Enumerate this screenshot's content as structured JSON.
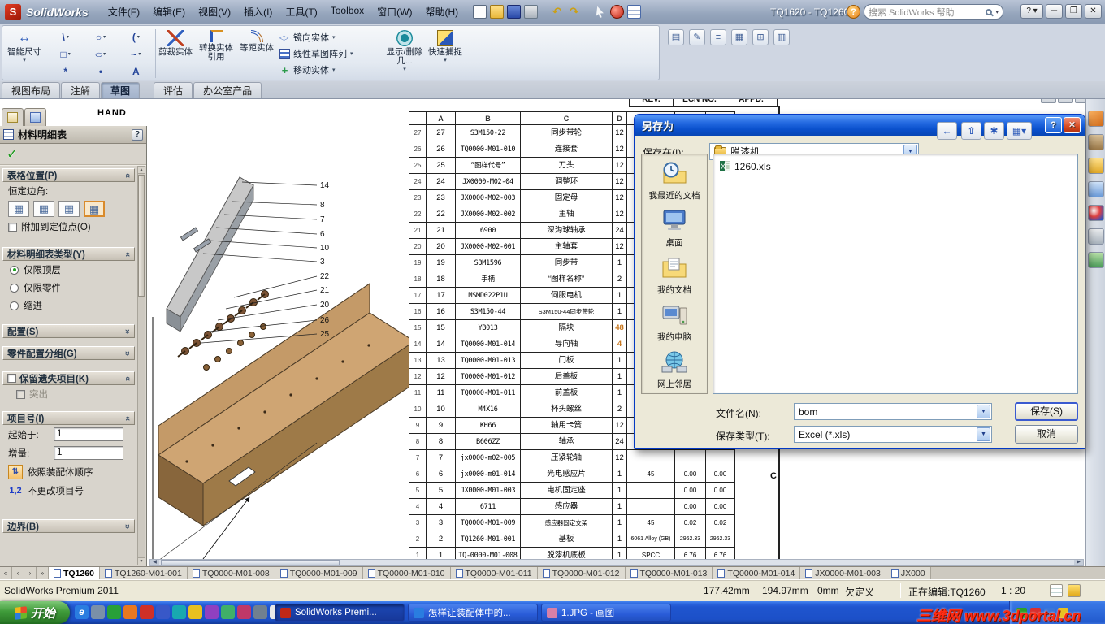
{
  "titlebar": {
    "app_name": "SolidWorks",
    "doc_title": "TQ1620 - TQ1260",
    "search_placeholder": "搜索 SolidWorks 帮助",
    "menus": [
      "文件(F)",
      "编辑(E)",
      "视图(V)",
      "插入(I)",
      "工具(T)",
      "Toolbox",
      "窗口(W)",
      "帮助(H)"
    ]
  },
  "ribbon": {
    "smart_dimension": "智能尺寸",
    "big_buttons": [
      "剪裁实体",
      "转换实体引用",
      "等距实体"
    ],
    "text_buttons": [
      "镜向实体",
      "线性草图阵列",
      "移动实体"
    ],
    "right_big_buttons": [
      "显示/删除几...",
      "快速捕捉"
    ],
    "tabs": [
      {
        "label": "视图布局",
        "active": false
      },
      {
        "label": "注解",
        "active": false
      },
      {
        "label": "草图",
        "active": true
      },
      {
        "label": "评估",
        "active": false
      },
      {
        "label": "办公室产品",
        "active": false
      }
    ]
  },
  "panel": {
    "title": "材料明细表",
    "help": "?",
    "table_position": {
      "header": "表格位置(P)",
      "anchor_label": "恒定边角:",
      "attach_label": "附加到定位点(O)"
    },
    "bom_type": {
      "header": "材料明细表类型(Y)",
      "options": [
        "仅限顶层",
        "仅限零件",
        "缩进"
      ],
      "selected": "仅限顶层"
    },
    "configurations_header": "配置(S)",
    "part_grouping_header": "零件配置分组(G)",
    "keep_missing": {
      "header": "保留遗失项目(K)",
      "strikeout_label": "突出"
    },
    "item_numbers": {
      "header": "项目号(I)",
      "start_label": "起始于:",
      "start_value": "1",
      "increment_label": "增量:",
      "increment_value": "1",
      "follow_assembly_label": "依照装配体顺序",
      "badge": "1,2",
      "no_change_label": "不更改项目号"
    },
    "border_header": "边界(B)"
  },
  "drawing": {
    "note": "HAND",
    "zone_letter": "C",
    "rev_headers": [
      "REV.",
      "ECN NO.",
      "APPD."
    ],
    "balloons": [
      "14",
      "8",
      "7",
      "6",
      "10",
      "3",
      "22",
      "21",
      "20",
      "26",
      "25"
    ],
    "bom": {
      "zone_cols": [
        "A",
        "B",
        "C",
        "D"
      ],
      "rows": [
        {
          "item": "27",
          "part": "S3M150-22",
          "desc": "同步带轮",
          "qty": "12"
        },
        {
          "item": "26",
          "part": "TQ0000-M01-010",
          "desc": "连接套",
          "qty": "12"
        },
        {
          "item": "25",
          "part": "“图样代号”",
          "desc": "刀头",
          "qty": "12"
        },
        {
          "item": "24",
          "part": "JX0000-M02-04",
          "desc": "调整环",
          "qty": "12"
        },
        {
          "item": "23",
          "part": "JX0000-M02-003",
          "desc": "固定母",
          "qty": "12"
        },
        {
          "item": "22",
          "part": "JX0000-M02-002",
          "desc": "主轴",
          "qty": "12"
        },
        {
          "item": "21",
          "part": "6900",
          "desc": "深沟球轴承",
          "qty": "24"
        },
        {
          "item": "20",
          "part": "JX0000-M02-001",
          "desc": "主轴套",
          "qty": "12"
        },
        {
          "item": "19",
          "part": "S3M1596",
          "desc": "同步带",
          "qty": "1"
        },
        {
          "item": "18",
          "part": "手柄",
          "desc": "“图样名称”",
          "qty": "2"
        },
        {
          "item": "17",
          "part": "MSMD022P1U",
          "desc": "伺服电机",
          "qty": "1"
        },
        {
          "item": "16",
          "part": "S3M150-44",
          "desc": "S3M150-44同步带轮",
          "qty": "1"
        },
        {
          "item": "15",
          "part": "YB013",
          "desc": "隔块",
          "qty": "48",
          "highlight": true
        },
        {
          "item": "14",
          "part": "TQ0000-M01-014",
          "desc": "导向轴",
          "qty": "4",
          "highlight": true
        },
        {
          "item": "13",
          "part": "TQ0000-M01-013",
          "desc": "门板",
          "qty": "1"
        },
        {
          "item": "12",
          "part": "TQ0000-M01-012",
          "desc": "后盖板",
          "qty": "1"
        },
        {
          "item": "11",
          "part": "TQ0000-M01-011",
          "desc": "前盖板",
          "qty": "1"
        },
        {
          "item": "10",
          "part": "M4X16",
          "desc": "杯头螺丝",
          "qty": "2"
        },
        {
          "item": "9",
          "part": "KH66",
          "desc": "轴用卡簧",
          "qty": "12"
        },
        {
          "item": "8",
          "part": "B606ZZ",
          "desc": "轴承",
          "qty": "24"
        },
        {
          "item": "7",
          "part": "jx0000-m02-005",
          "desc": "压紧轮轴",
          "qty": "12"
        },
        {
          "item": "6",
          "part": "jx0000-m01-014",
          "desc": "光电感应片",
          "qty": "1",
          "material": "45",
          "weight": "0.00",
          "total": "0.00"
        },
        {
          "item": "5",
          "part": "JX0000-M01-003",
          "desc": "电机固定座",
          "qty": "1",
          "material": "",
          "weight": "0.00",
          "total": "0.00"
        },
        {
          "item": "4",
          "part": "6711",
          "desc": "感应器",
          "qty": "1",
          "material": "",
          "weight": "0.00",
          "total": "0.00"
        },
        {
          "item": "3",
          "part": "TQ0000-M01-009",
          "desc": "感应器固定支架",
          "qty": "1",
          "material": "45",
          "weight": "0.02",
          "total": "0.02"
        },
        {
          "item": "2",
          "part": "TQ1260-M01-001",
          "desc": "基板",
          "qty": "1",
          "material": "6061 Alloy (GB)",
          "weight": "2962.33",
          "total": "2962.33"
        },
        {
          "item": "1",
          "part": "TQ-0000-M01-008",
          "desc": "脱漆机底板",
          "qty": "1",
          "material": "SPCC",
          "weight": "6.76",
          "total": "6.76"
        }
      ]
    }
  },
  "save_dialog": {
    "title": "另存为",
    "save_in_label": "保存在(I):",
    "save_in_value": "脱漆机",
    "places": [
      "我最近的文档",
      "桌面",
      "我的文档",
      "我的电脑",
      "网上邻居"
    ],
    "files": [
      "1260.xls"
    ],
    "filename_label": "文件名(N):",
    "filename_value": "bom",
    "filetype_label": "保存类型(T):",
    "filetype_value": "Excel (*.xls)",
    "save_label": "保存(S)",
    "cancel_label": "取消"
  },
  "sheet_tabs": [
    "TQ1260",
    "TQ1260-M01-001",
    "TQ0000-M01-008",
    "TQ0000-M01-009",
    "TQ0000-M01-010",
    "TQ0000-M01-011",
    "TQ0000-M01-012",
    "TQ0000-M01-013",
    "TQ0000-M01-014",
    "JX0000-M01-003",
    "JX000"
  ],
  "active_sheet": "TQ1260",
  "status": {
    "left": "SolidWorks Premium 2011",
    "x": "177.42mm",
    "y": "194.97mm",
    "z": "0mm",
    "state": "欠定义",
    "editing": "正在编辑:TQ1260",
    "scale": "1 : 20"
  },
  "taskbar": {
    "start_label": "开始",
    "tasks": [
      "SolidWorks Premi...",
      "怎样让装配体中的...",
      "1.JPG - 画图"
    ],
    "watermark": "三维网 www.3dportal.cn"
  }
}
